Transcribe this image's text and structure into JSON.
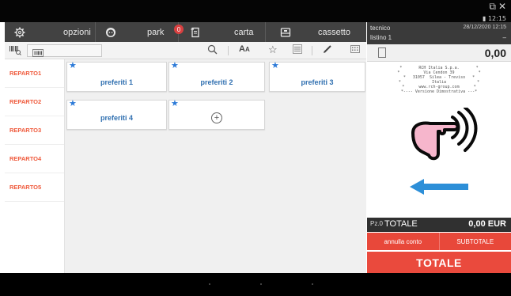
{
  "window": {
    "restore_glyph": "⧉",
    "close_glyph": "✕",
    "battery_glyph": "▮",
    "clock": "12:15"
  },
  "toolbar": {
    "options_label": "opzioni",
    "park_label": "park",
    "park_badge": "0",
    "card_label": "carta",
    "drawer_label": "cassetto"
  },
  "header": {
    "operator": "tecnico",
    "datetime": "28/12/2020 12:15",
    "price_list": "listino 1",
    "list_dash": "–"
  },
  "amount": {
    "display": "0,00"
  },
  "departments": [
    {
      "label": "REPARTO1"
    },
    {
      "label": "REPARTO2"
    },
    {
      "label": "REPARTO3"
    },
    {
      "label": "REPARTO4"
    },
    {
      "label": "REPARTO5"
    }
  ],
  "favorites": [
    {
      "label": "preferiti 1"
    },
    {
      "label": "preferiti 2"
    },
    {
      "label": "preferiti 3"
    },
    {
      "label": "preferiti 4"
    }
  ],
  "add_favorite_glyph": "+",
  "receipt_text": "*       RCH Italia S.p.a.       *\n*          Via Cendon 39          *\n*   31057  Silea - Treviso   *\n*             Italia             *\n*      www.rch-group.com      *\n*---- Versione Dimostrativa ---*",
  "totals": {
    "pieces_label": "Pz.0",
    "total_label": "TOTALE",
    "total_value": "0,00 EUR"
  },
  "buttons": {
    "cancel_bill": "annulla conto",
    "subtotal": "SUBTOTALE",
    "total": "TOTALE"
  },
  "colors": {
    "accent_red": "#ea4a3d",
    "department_text": "#ef5a3c",
    "favorite_text": "#2f6fb0",
    "star": "#2c7ad8",
    "hint_arrow": "#2d8fd8",
    "hint_hand": "#f6b6cc"
  },
  "icons": {
    "options": "gear-icon",
    "park": "face-icon",
    "card": "card-icon",
    "drawer": "drawer-icon",
    "search": "search-icon",
    "font": "font-size-icon",
    "star": "star-icon",
    "list": "list-icon",
    "edit": "pencil-icon",
    "calc": "calculator-icon"
  }
}
